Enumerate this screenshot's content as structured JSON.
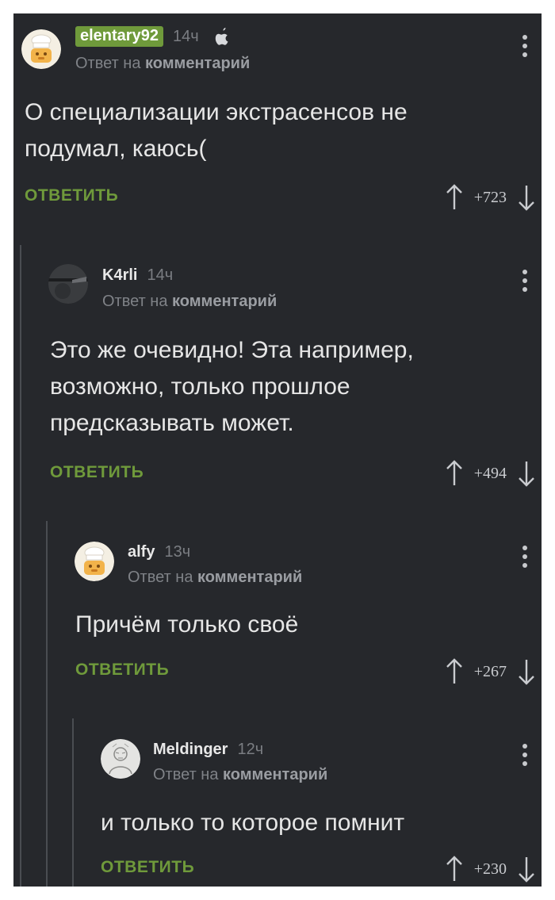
{
  "comments": [
    {
      "username": "elentary92",
      "time": "14ч",
      "reply_prefix": "Ответ на",
      "reply_target": "комментарий",
      "text_lines": [
        "О специализации экстрасенсов не",
        "подумал, каюсь("
      ],
      "reply_label": "ОТВЕТИТЬ",
      "score": "+723"
    },
    {
      "username": "K4rli",
      "time": "14ч",
      "reply_prefix": "Ответ на",
      "reply_target": "комментарий",
      "text_lines": [
        "Это же очевидно! Эта например,",
        "возможно, только прошлое",
        "предсказывать может."
      ],
      "reply_label": "ОТВЕТИТЬ",
      "score": "+494"
    },
    {
      "username": "alfy",
      "time": "13ч",
      "reply_prefix": "Ответ на",
      "reply_target": "комментарий",
      "text_lines": [
        "Причём только своё"
      ],
      "reply_label": "ОТВЕТИТЬ",
      "score": "+267"
    },
    {
      "username": "Meldinger",
      "time": "12ч",
      "reply_prefix": "Ответ на",
      "reply_target": "комментарий",
      "text_lines": [
        "и только то которое помнит"
      ],
      "reply_label": "ОТВЕТИТЬ",
      "score": "+230"
    }
  ],
  "icons": {
    "platform": "apple-icon",
    "more": "more-vertical-icon",
    "upvote": "arrow-up-icon",
    "downvote": "arrow-down-icon"
  },
  "colors": {
    "background": "#26282c",
    "accent_green": "#6f9a3b",
    "text": "#e6e6e6",
    "muted": "#7f8287"
  }
}
